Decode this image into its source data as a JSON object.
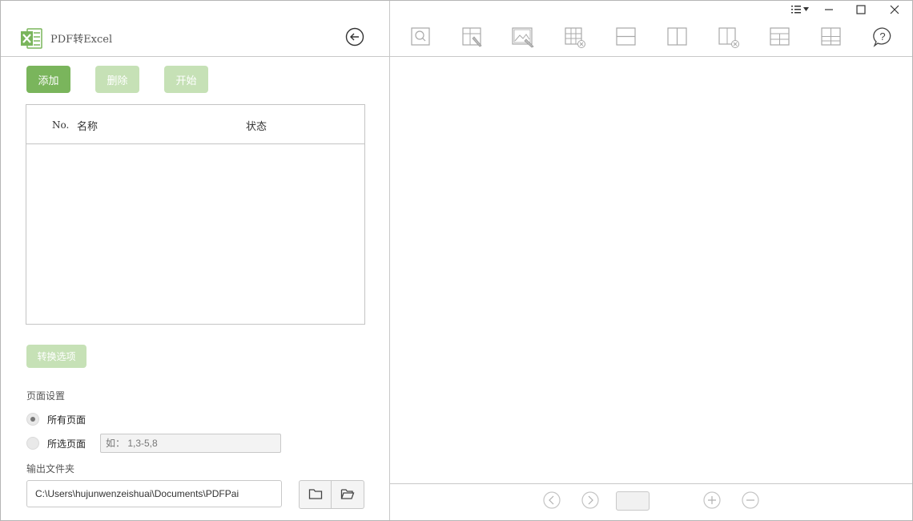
{
  "app": {
    "title": "PDF转Excel"
  },
  "actions": {
    "add_label": "添加",
    "delete_label": "删除",
    "start_label": "开始"
  },
  "file_table": {
    "columns": [
      "No.",
      "名称",
      "状态"
    ],
    "rows": []
  },
  "options": {
    "convert_options_label": "转换选项",
    "page_settings_label": "页面设置",
    "all_pages_label": "所有页面",
    "selected_pages_label": "所选页面",
    "selected_pages_placeholder": "如： 1,3-5,8",
    "page_mode": "all"
  },
  "output": {
    "folder_label": "输出文件夹",
    "path_value": "C:\\Users\\hujunwenzeishuai\\Documents\\PDFPai"
  },
  "toolbar": {
    "icons": [
      "zoom-icon",
      "draw-table-icon",
      "select-image-icon",
      "delete-table-icon",
      "horizontal-split-icon",
      "vertical-split-icon",
      "delete-line-icon",
      "merge-row-icon",
      "grid-icon",
      "help-icon"
    ]
  },
  "colors": {
    "accent": "#7ab55c",
    "accent_disabled": "#c6e1b6",
    "icon_gray": "#a8a8a8"
  }
}
